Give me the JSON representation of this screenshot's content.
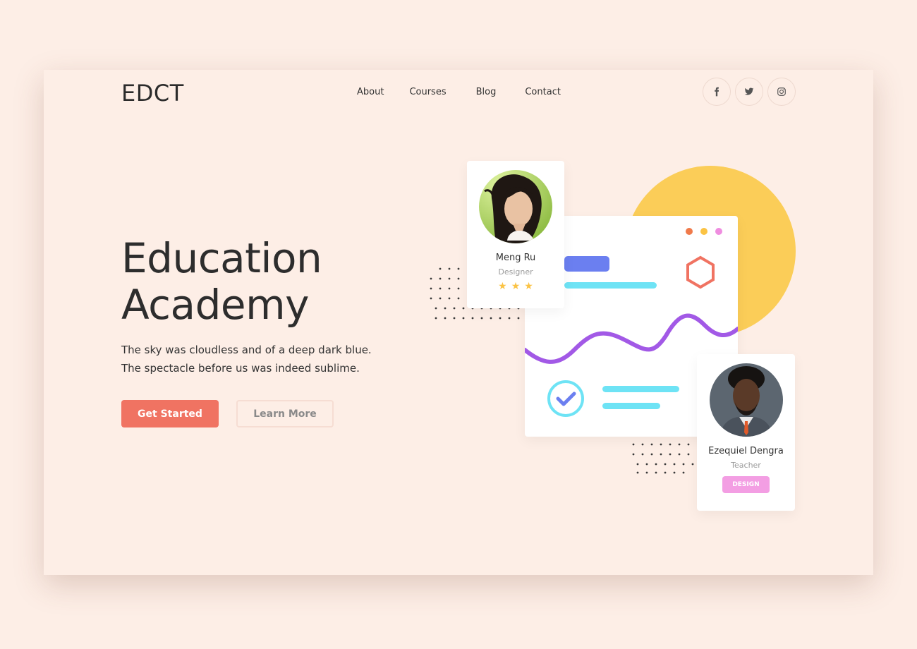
{
  "brand": {
    "logo": "EDCT"
  },
  "nav": {
    "items": [
      "About",
      "Courses",
      "Blog",
      "Contact"
    ]
  },
  "social": [
    {
      "name": "facebook-icon"
    },
    {
      "name": "twitter-icon"
    },
    {
      "name": "instagram-icon"
    }
  ],
  "hero": {
    "title_line1": "Education",
    "title_line2": "Academy",
    "desc_line1": "The sky was cloudless and of a deep dark blue.",
    "desc_line2": "The spectacle before us was indeed sublime.",
    "primary_cta": "Get Started",
    "secondary_cta": "Learn More"
  },
  "profiles": [
    {
      "name": "Meng Ru",
      "role": "Designer",
      "rating": 3
    },
    {
      "name": "Ezequiel Dengra",
      "role": "Teacher",
      "badge": "DESIGN"
    }
  ],
  "colors": {
    "background": "#fdeee6",
    "accent": "#f07362",
    "yellow": "#fbcd58",
    "purple_wave": "#a259e6",
    "cyan": "#6ee3f5",
    "blue_bar": "#6b7ff0",
    "badge_pink": "#f39ee3",
    "window_dots": [
      "#f07a4a",
      "#fbc344",
      "#ef8de0"
    ]
  }
}
